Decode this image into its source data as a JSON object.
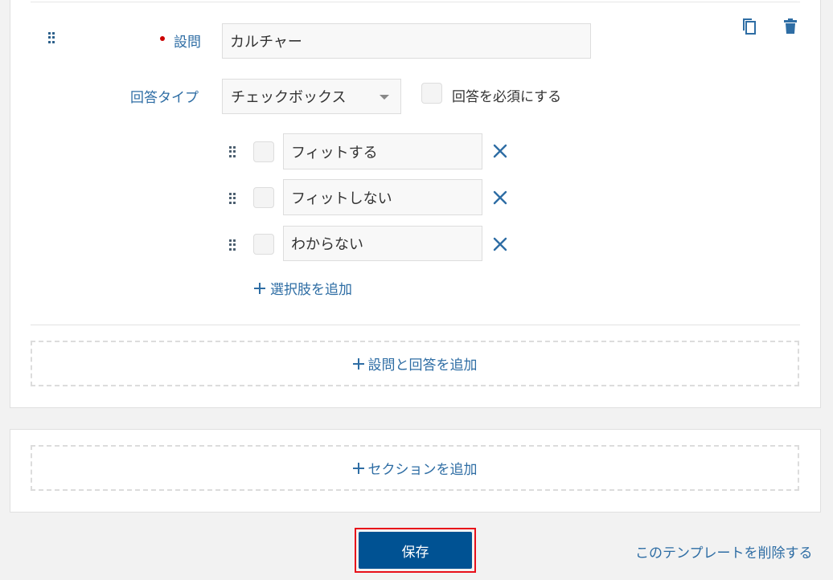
{
  "question": {
    "label": "設問",
    "value": "カルチャー",
    "answer_type_label": "回答タイプ",
    "answer_type_value": "チェックボックス",
    "required_label": "回答を必須にする",
    "options": [
      {
        "value": "フィットする"
      },
      {
        "value": "フィットしない"
      },
      {
        "value": "わからない"
      }
    ],
    "add_option_label": "選択肢を追加"
  },
  "add_question_label": "設問と回答を追加",
  "add_section_label": "セクションを追加",
  "footer": {
    "save_label": "保存",
    "delete_template_label": "このテンプレートを削除する"
  },
  "colors": {
    "accent": "#2e6da4",
    "primary_button": "#005293",
    "required": "#cc0000",
    "highlight_border": "#e8101a"
  }
}
